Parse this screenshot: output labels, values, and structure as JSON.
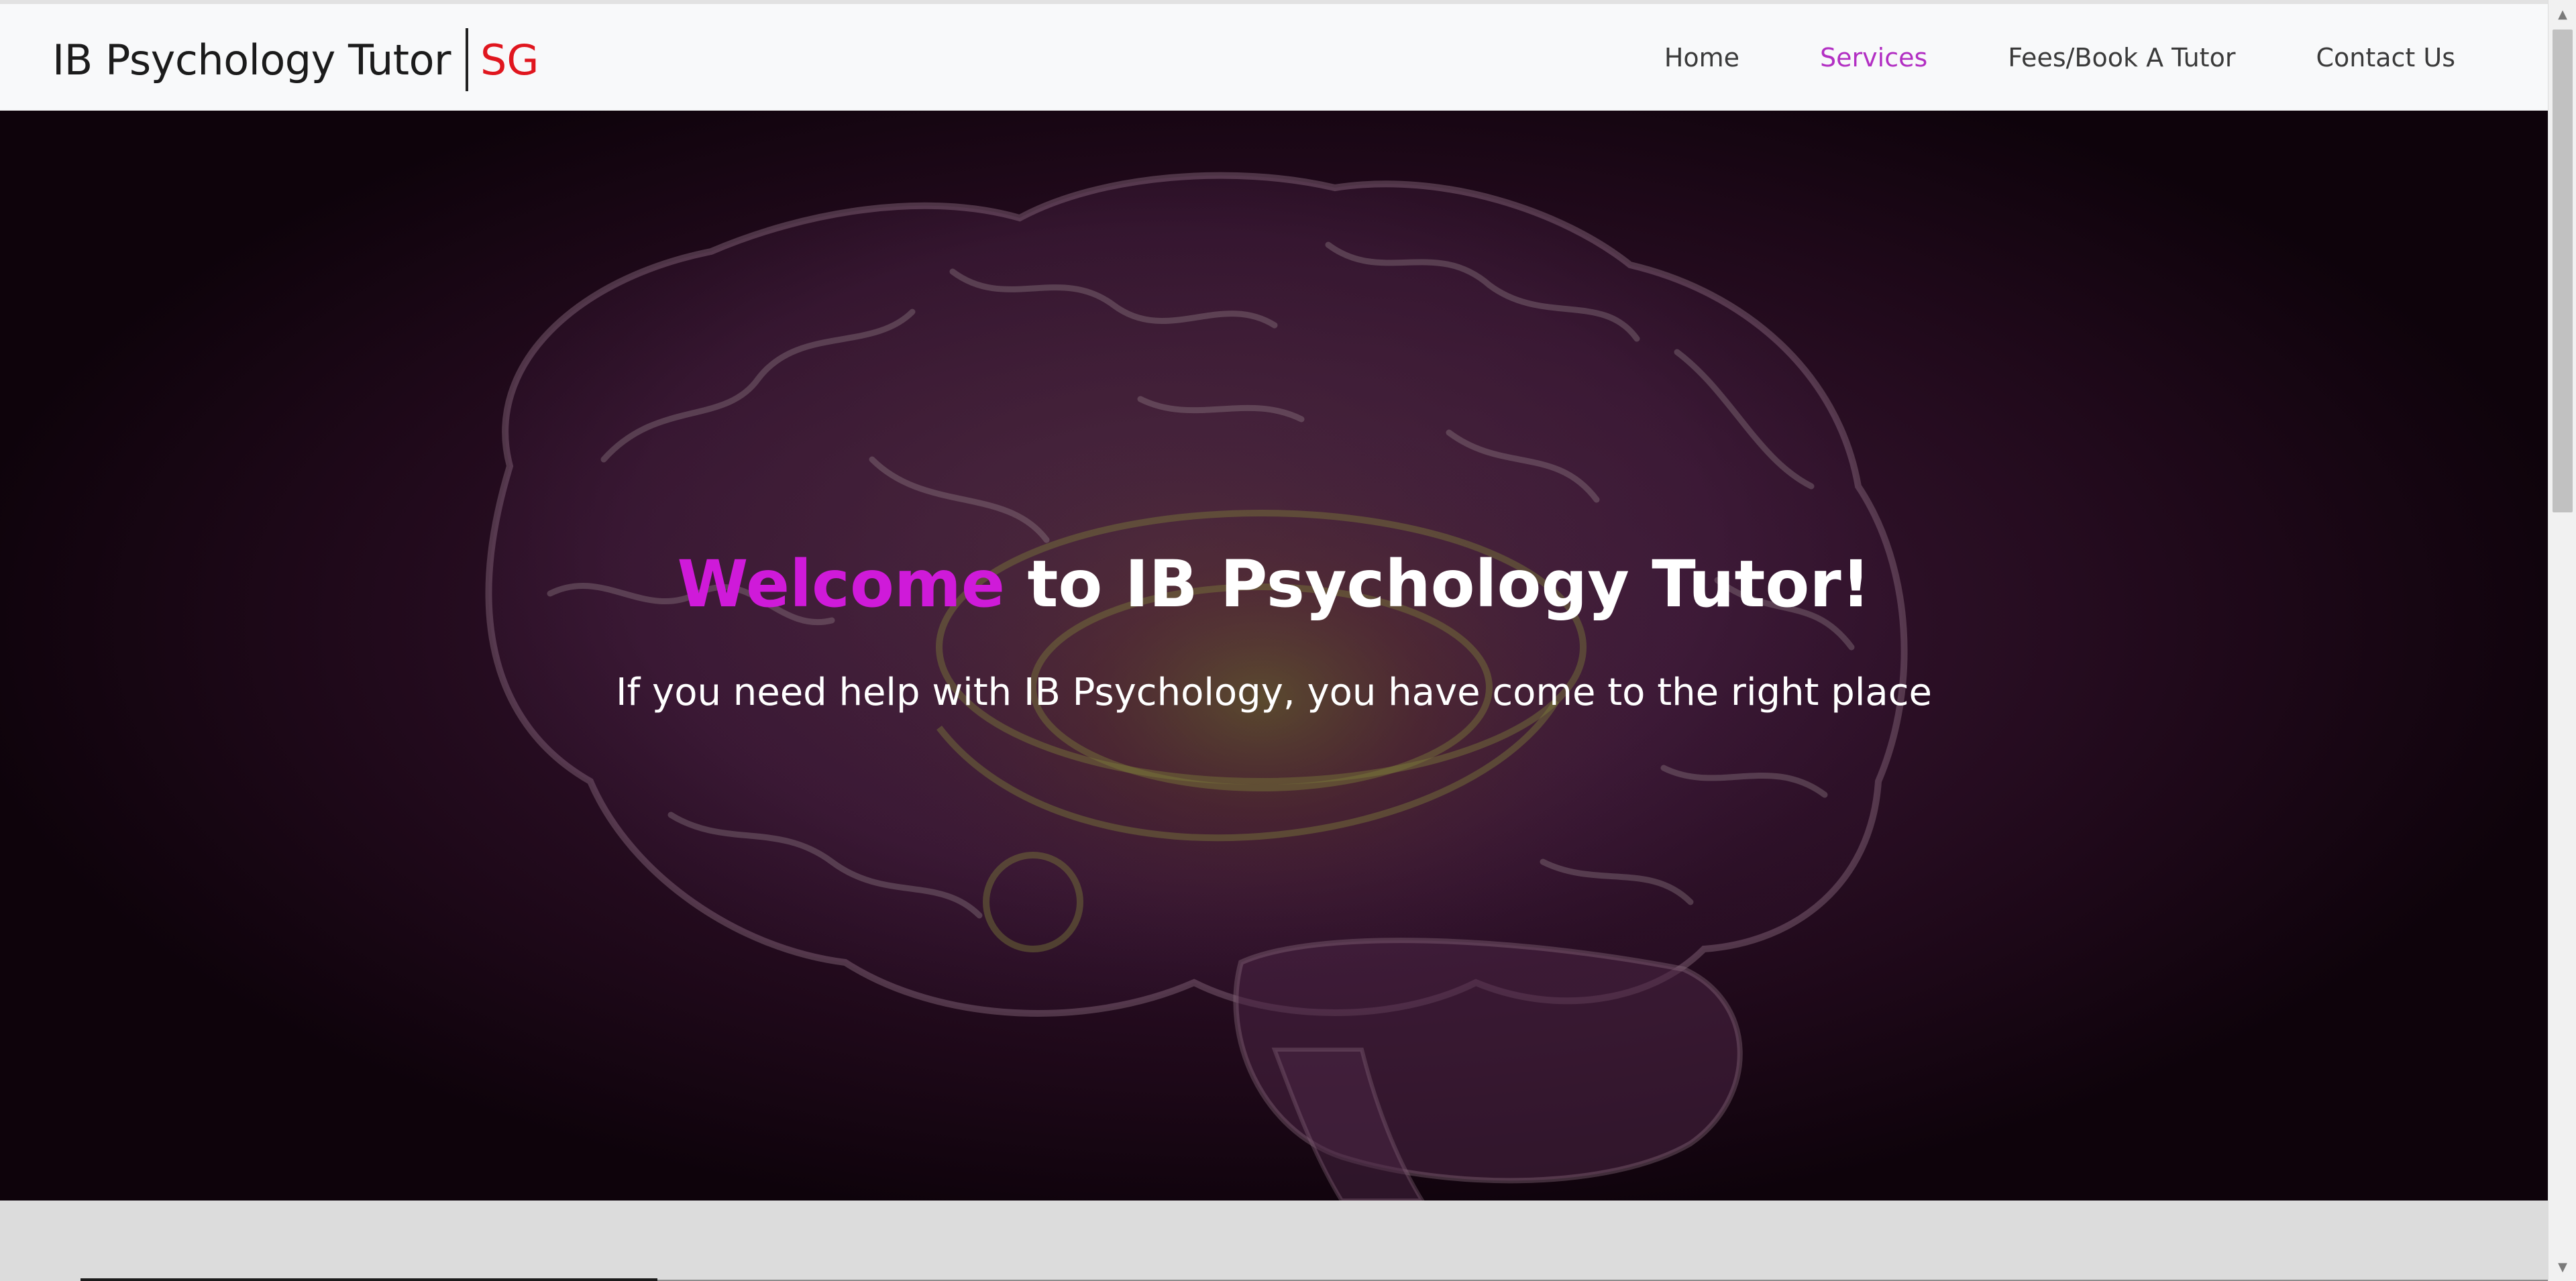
{
  "navbar": {
    "brand_name": "IB Psychology Tutor",
    "brand_suffix": "SG",
    "links": [
      {
        "label": "Home",
        "active": false
      },
      {
        "label": "Services",
        "active": true
      },
      {
        "label": "Fees/Book A Tutor",
        "active": false
      },
      {
        "label": "Contact Us",
        "active": false
      }
    ]
  },
  "hero": {
    "title_accent": "Welcome",
    "title_rest": " to IB Psychology Tutor!",
    "subtitle": "If you need help with IB Psychology, you have come to the right place",
    "background_image": "brain-illustration"
  },
  "scrollbar": {
    "up_icon": "arrow-up-icon",
    "down_icon": "arrow-down-icon"
  },
  "colors": {
    "accent": "#cf1ad9",
    "nav_active": "#b22fc3",
    "brand_suffix": "#e0161e",
    "hero_bg": "#2d1027"
  }
}
